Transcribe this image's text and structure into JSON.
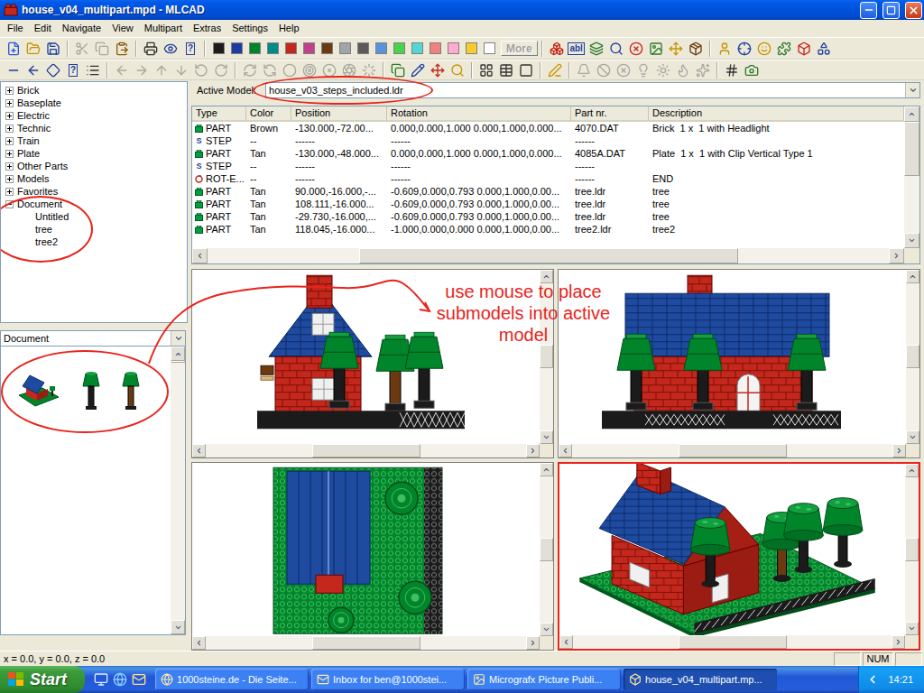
{
  "window": {
    "title": "house_v04_multipart.mpd - MLCAD"
  },
  "menu": [
    "File",
    "Edit",
    "Navigate",
    "View",
    "Multipart",
    "Extras",
    "Settings",
    "Help"
  ],
  "toolbars": [
    {
      "groups": [
        [
          {
            "disabled": false
          },
          {
            "disabled": false
          },
          {
            "disabled": false
          }
        ],
        [
          {
            "disabled": true
          },
          {
            "disabled": true
          },
          {
            "disabled": false
          }
        ],
        [
          {
            "disabled": false
          },
          {
            "disabled": false
          },
          {
            "disabled": false,
            "text": "?"
          }
        ],
        [
          {
            "disabled": false
          },
          {
            "disabled": false,
            "text": "abl"
          },
          {
            "disabled": false
          },
          {
            "disabled": false
          },
          {
            "disabled": false
          },
          {
            "disabled": false
          },
          {
            "disabled": false
          },
          {
            "disabled": false
          }
        ],
        [
          {
            "disabled": false
          },
          {
            "disabled": false
          },
          {
            "disabled": false
          },
          {
            "disabled": false
          },
          {
            "disabled": false
          },
          {
            "disabled": false
          }
        ]
      ]
    },
    {
      "groups": [
        [
          {
            "disabled": false
          },
          {
            "disabled": false
          },
          {
            "disabled": false
          },
          {
            "disabled": false,
            "text": "?"
          },
          {
            "disabled": false
          }
        ],
        [
          {
            "disabled": true
          },
          {
            "disabled": true
          },
          {
            "disabled": true
          },
          {
            "disabled": true
          },
          {
            "disabled": true
          },
          {
            "disabled": true
          }
        ],
        [
          {
            "disabled": true
          },
          {
            "disabled": true
          },
          {
            "disabled": true
          },
          {
            "disabled": true
          },
          {
            "disabled": true
          },
          {
            "disabled": true
          },
          {
            "disabled": true
          }
        ],
        [
          {
            "disabled": false
          },
          {
            "disabled": false
          },
          {
            "disabled": false
          },
          {
            "disabled": false
          }
        ],
        [
          {
            "disabled": false
          },
          {
            "disabled": false
          },
          {
            "disabled": false
          }
        ],
        [
          {
            "disabled": false
          }
        ],
        [
          {
            "disabled": true
          },
          {
            "disabled": true
          },
          {
            "disabled": true
          },
          {
            "disabled": true
          },
          {
            "disabled": true
          },
          {
            "disabled": true
          },
          {
            "disabled": true
          }
        ],
        [
          {
            "disabled": false
          },
          {
            "disabled": false
          }
        ]
      ]
    }
  ],
  "palette": {
    "colors": [
      "#1b1b1b",
      "#1e3ca0",
      "#00852b",
      "#008a8a",
      "#c4281c",
      "#c0408a",
      "#6b3a10",
      "#a0a5a9",
      "#5a5a5a",
      "#5a93db",
      "#4bd24b",
      "#55d6d6",
      "#f28080",
      "#ffaad0",
      "#f5cd2f",
      "#ffffff"
    ],
    "more": {
      "label": "More",
      "disabled": true
    }
  },
  "tree": [
    {
      "label": "Brick",
      "expanded": false,
      "children": []
    },
    {
      "label": "Baseplate",
      "expanded": false,
      "children": []
    },
    {
      "label": "Electric",
      "expanded": false,
      "children": []
    },
    {
      "label": "Technic",
      "expanded": false,
      "children": []
    },
    {
      "label": "Train",
      "expanded": false,
      "children": []
    },
    {
      "label": "Plate",
      "expanded": false,
      "children": []
    },
    {
      "label": "Other Parts",
      "expanded": false,
      "children": []
    },
    {
      "label": "Models",
      "expanded": false,
      "children": []
    },
    {
      "label": "Favorites",
      "expanded": false,
      "children": []
    },
    {
      "label": "Document",
      "expanded": true,
      "children": [
        "Untitled",
        "tree",
        "tree2"
      ]
    }
  ],
  "preview": {
    "dropdown": "Document",
    "thumbnails": [
      {
        "kind": "house"
      },
      {
        "kind": "tree"
      },
      {
        "kind": "tree2"
      }
    ]
  },
  "active_model": {
    "label": "Active Model:",
    "value": "house_v03_steps_included.ldr"
  },
  "table": {
    "columns": [
      "Type",
      "Color",
      "Position",
      "Rotation",
      "Part nr.",
      "Description"
    ],
    "rows": [
      {
        "kind": "part",
        "type": "PART",
        "color": "Brown",
        "position": "-130.000,-72.00...",
        "rotation": "0.000,0.000,1.000 0.000,1.000,0.000...",
        "part": "4070.DAT",
        "description": "Brick  1 x  1 with Headlight"
      },
      {
        "kind": "step",
        "mark": "S",
        "type": "STEP",
        "color": "--",
        "position": "------",
        "rotation": "------",
        "part": "------",
        "description": ""
      },
      {
        "kind": "part",
        "type": "PART",
        "color": "Tan",
        "position": "-130.000,-48.000...",
        "rotation": "0.000,0.000,1.000 0.000,1.000,0.000...",
        "part": "4085A.DAT",
        "description": "Plate  1 x  1 with Clip Vertical Type 1"
      },
      {
        "kind": "step",
        "mark": "S",
        "type": "STEP",
        "color": "--",
        "position": "------",
        "rotation": "------",
        "part": "------",
        "description": ""
      },
      {
        "kind": "rot",
        "type": "ROT-E...",
        "color": "--",
        "position": "------",
        "rotation": "------",
        "part": "------",
        "description": "END"
      },
      {
        "kind": "part",
        "type": "PART",
        "color": "Tan",
        "position": "90.000,-16.000,-...",
        "rotation": "-0.609,0.000,0.793 0.000,1.000,0.00...",
        "part": "tree.ldr",
        "description": "tree"
      },
      {
        "kind": "part",
        "type": "PART",
        "color": "Tan",
        "position": "108.111,-16.000...",
        "rotation": "-0.609,0.000,0.793 0.000,1.000,0.00...",
        "part": "tree.ldr",
        "description": "tree"
      },
      {
        "kind": "part",
        "type": "PART",
        "color": "Tan",
        "position": "-29.730,-16.000,...",
        "rotation": "-0.609,0.000,0.793 0.000,1.000,0.00...",
        "part": "tree.ldr",
        "description": "tree"
      },
      {
        "kind": "part",
        "type": "PART",
        "color": "Tan",
        "position": "118.045,-16.000...",
        "rotation": "-1.000,0.000,0.000 0.000,1.000,0.00...",
        "part": "tree2.ldr",
        "description": "tree2"
      }
    ]
  },
  "views": [
    {
      "kind": "front",
      "selected": false
    },
    {
      "kind": "back",
      "selected": false
    },
    {
      "kind": "top",
      "selected": false
    },
    {
      "kind": "perspective",
      "selected": true
    }
  ],
  "annotation": {
    "text": "use mouse to place submodels into active model"
  },
  "status_bar": {
    "coords": "x = 0.0, y = 0.0, z = 0.0",
    "indicators": [
      "NUM"
    ]
  },
  "taskbar": {
    "start": "Start",
    "tasks": [
      {
        "label": "1000steine.de - Die Seite...",
        "selected": false
      },
      {
        "label": "Inbox for ben@1000stei...",
        "selected": false
      },
      {
        "label": "Micrografx Picture Publi...",
        "selected": false
      },
      {
        "label": "house_v04_multipart.mp...",
        "selected": true
      }
    ],
    "clock": "14:21"
  }
}
